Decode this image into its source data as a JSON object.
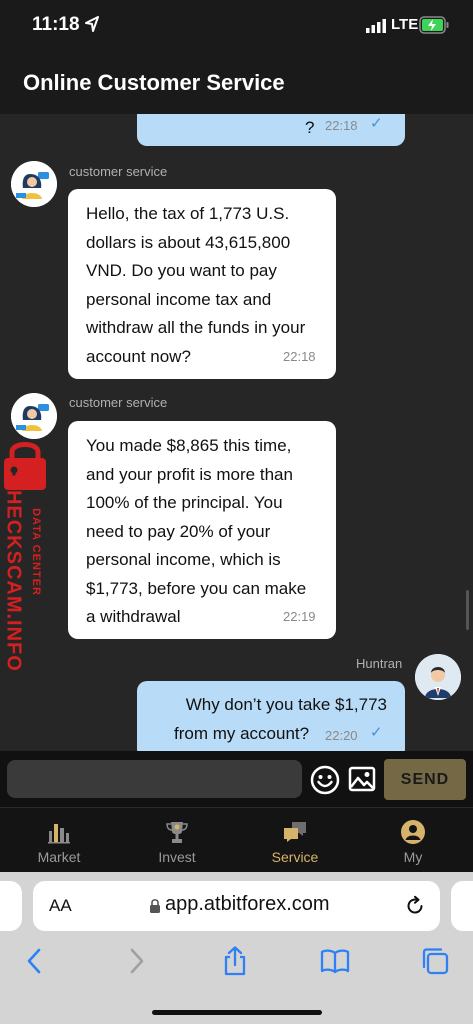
{
  "status_bar": {
    "time": "11:18",
    "network": "LTE"
  },
  "header": {
    "title": "Online Customer Service"
  },
  "messages": [
    {
      "direction": "out",
      "sender": "",
      "text": "?",
      "time": "22:18"
    },
    {
      "direction": "in",
      "sender": "customer service",
      "lines": [
        "Hello, the tax of 1,773 U.S.",
        "dollars is about 43,615,800",
        "VND. Do you want to pay",
        "personal income tax and",
        "withdraw all the funds in your",
        "account now?"
      ],
      "time": "22:18"
    },
    {
      "direction": "in",
      "sender": "customer service",
      "lines": [
        "You made $8,865 this time,",
        "and your profit is more than",
        "100% of the principal. You",
        "need to pay 20% of your",
        "personal income, which is",
        "$1,773, before you can make",
        "a withdrawal"
      ],
      "time": "22:19"
    },
    {
      "direction": "out",
      "sender": "Huntran",
      "lines": [
        "Why don’t you take $1,773",
        "from my account?"
      ],
      "time": "22:20"
    }
  ],
  "watermark": {
    "line1": "DATA CENTER",
    "line2": "CHECKSCAM.INFO"
  },
  "input": {
    "placeholder": "",
    "send_label": "SEND"
  },
  "tabs": [
    {
      "label": "Market",
      "icon": "bar-chart-icon",
      "active": false
    },
    {
      "label": "Invest",
      "icon": "trophy-icon",
      "active": false
    },
    {
      "label": "Service",
      "icon": "chat-bubbles-icon",
      "active": true
    },
    {
      "label": "My",
      "icon": "user-icon",
      "active": false
    }
  ],
  "browser": {
    "text_size_label": "AA",
    "url": "app.atbitforex.com"
  },
  "colors": {
    "accent": "#d6b36a",
    "send_button": "#756945",
    "outgoing_bubble": "#b8dcf8"
  }
}
